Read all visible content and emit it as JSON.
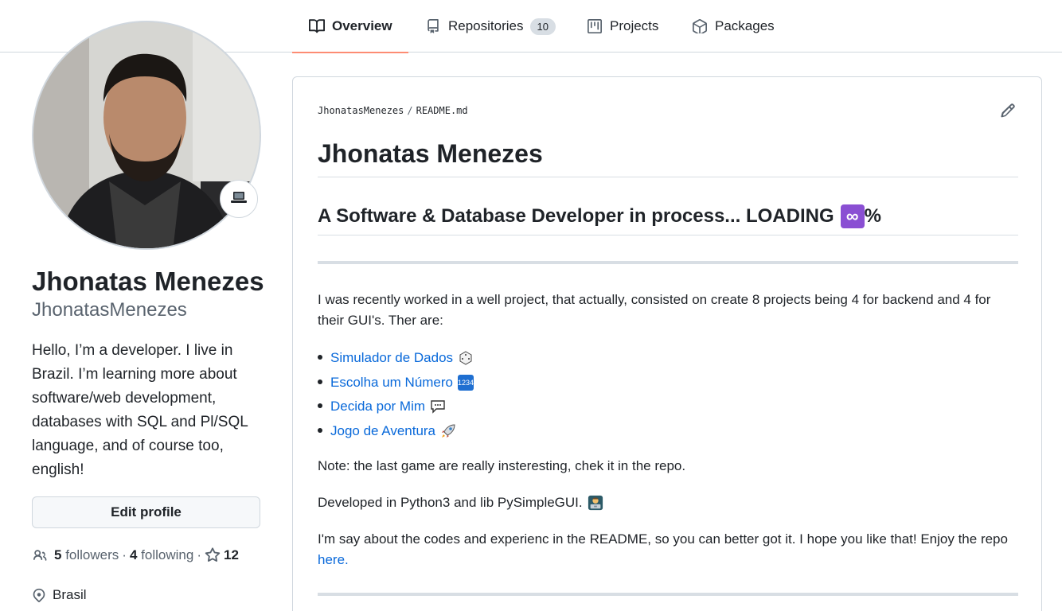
{
  "nav": {
    "tabs": [
      {
        "label": "Overview",
        "icon": "book-icon",
        "active": true
      },
      {
        "label": "Repositories",
        "icon": "repo-icon",
        "count": "10"
      },
      {
        "label": "Projects",
        "icon": "project-icon"
      },
      {
        "label": "Packages",
        "icon": "package-icon"
      }
    ]
  },
  "profile": {
    "name": "Jhonatas Menezes",
    "login": "JhonatasMenezes",
    "bio": "Hello, I’m a developer. I live in Brazil. I’m learning more about software/web development, databases with SQL and Pl/SQL language, and of course too, english!",
    "edit_label": "Edit profile",
    "followers_count": "5",
    "followers_label": "followers",
    "following_count": "4",
    "following_label": "following",
    "stars_count": "12",
    "location": "Brasil",
    "status_icon": "laptop-icon"
  },
  "readme": {
    "crumb_user": "JhonatasMenezes",
    "crumb_sep": "/",
    "crumb_file": "README.md",
    "title": "Jhonatas Menezes",
    "subtitle": "A Software & Database Developer in process... LOADING",
    "subtitle_badge": "∞",
    "subtitle_tail": "%",
    "intro": "I was recently worked in a well project, that actually, consisted on create 8 projects being 4 for backend and 4 for their GUI's. Ther are:",
    "projects": [
      {
        "label": "Simulador de Dados",
        "emoji": "🎲"
      },
      {
        "label": "Escolha um Número",
        "emoji": "🔢"
      },
      {
        "label": "Decida por Mim",
        "emoji": "💬"
      },
      {
        "label": "Jogo de Aventura",
        "emoji": "🚀"
      }
    ],
    "note": "Note: the last game are really insteresting, chek it in the repo.",
    "developed": "Developed in Python3 and lib PySimpleGUI.",
    "developed_emoji": "🧑‍💻",
    "outro": "I'm say about the codes and experienc in the README, so you can better got it. I hope you like that! Enjoy the repo",
    "outro_link": "here."
  }
}
